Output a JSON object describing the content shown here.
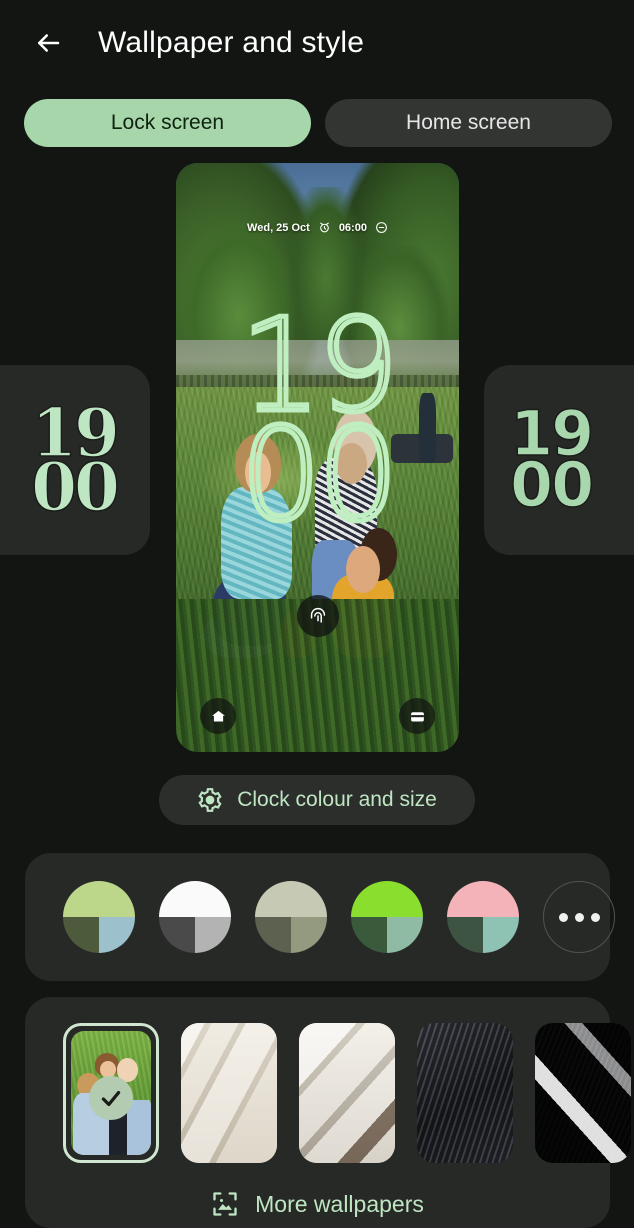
{
  "header": {
    "back_icon": "arrow-left-icon",
    "title": "Wallpaper and style"
  },
  "segmented_control": {
    "tabs": [
      {
        "label": "Lock screen",
        "selected": true
      },
      {
        "label": "Home screen",
        "selected": false
      }
    ],
    "active_bg": "#a6d6aa",
    "active_text": "#10230f",
    "inactive_bg": "#333533"
  },
  "clock_styles": {
    "left_card": {
      "hours": "19",
      "minutes": "00",
      "style_name": "decorative-serif"
    },
    "right_card": {
      "hours": "19",
      "minutes": "00",
      "style_name": "bold-rounded"
    }
  },
  "preview": {
    "status": {
      "date": "Wed, 25 Oct",
      "alarm_icon": "alarm-clock-icon",
      "alarm_time": "06:00",
      "dnd_icon": "do-not-disturb-icon"
    },
    "clock": {
      "hours": "19",
      "minutes": "00",
      "color": "#bfeec0"
    },
    "fingerprint_icon": "fingerprint-icon",
    "shortcut_left_icon": "home-controls-icon",
    "shortcut_right_icon": "wallet-icon"
  },
  "clock_settings_button": {
    "icon": "gear-icon",
    "label": "Clock colour and size",
    "text_color": "#bfe6c2"
  },
  "colors": {
    "swatches": [
      {
        "name": "lime-sage",
        "top": "#bcd68a",
        "bottom_left": "#4e5a3c",
        "bottom_right": "#9cc0cc"
      },
      {
        "name": "mono-white",
        "top": "#fafafa",
        "bottom_left": "#4a4a4a",
        "bottom_right": "#b3b3b3"
      },
      {
        "name": "sage-grey",
        "top": "#c6cab4",
        "bottom_left": "#5d6150",
        "bottom_right": "#939a80"
      },
      {
        "name": "vivid-green",
        "top": "#8ade2e",
        "bottom_left": "#3a5a3c",
        "bottom_right": "#8fbba4"
      },
      {
        "name": "blush-pink",
        "top": "#f4b3b8",
        "bottom_left": "#3e5442",
        "bottom_right": "#8ec2b2"
      }
    ],
    "more_button": {
      "name": "more-colors",
      "icon": "three-dots-icon"
    }
  },
  "wallpapers": {
    "thumbnails": [
      {
        "name": "photo-kids-on-grass",
        "selected": true,
        "check_icon": "check-icon"
      },
      {
        "name": "cream-feather-1",
        "selected": false
      },
      {
        "name": "cream-feather-2",
        "selected": false
      },
      {
        "name": "dark-feather-1",
        "selected": false
      },
      {
        "name": "dark-feather-2",
        "selected": false
      }
    ],
    "more_wallpapers": {
      "icon": "image-icon",
      "label": "More wallpapers",
      "text_color": "#bfe6c2"
    }
  }
}
